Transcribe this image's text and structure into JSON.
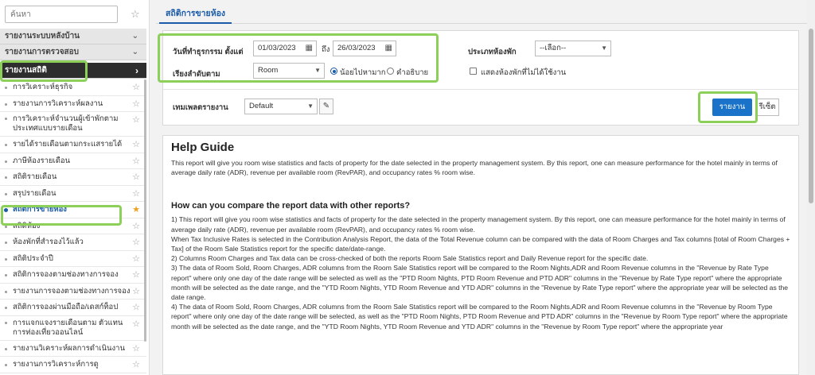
{
  "sidebar": {
    "search_placeholder": "ค้นหา",
    "groups": [
      {
        "label": "รายงานระบบหลังบ้าน"
      },
      {
        "label": "รายงานการตรวจสอบ"
      },
      {
        "label": "รายงานสถิติ"
      }
    ],
    "items": [
      {
        "label": "การวิเคราะห์ธุรกิจ"
      },
      {
        "label": "รายงานการวิเคราะห์ผลงาน"
      },
      {
        "label": "การวิเคราะห์จำนวนผู้เข้าพักตามประเทศแบบรายเดือน"
      },
      {
        "label": "รายได้รายเดือนตามกระแสรายได้"
      },
      {
        "label": "ภาษีห้องรายเดือน"
      },
      {
        "label": "สถิติรายเดือน"
      },
      {
        "label": "สรุปรายเดือน"
      },
      {
        "label": "สถิติการขายห้อง"
      },
      {
        "label": "สถิติห้อง"
      },
      {
        "label": "ห้องพักที่สำรองไว้แล้ว"
      },
      {
        "label": "สถิติประจำปี"
      },
      {
        "label": "สถิติการจองตามช่องทางการจอง"
      },
      {
        "label": "รายงานการจองตามช่องทางการจอง"
      },
      {
        "label": "สถิติการจองผ่านมือถือ/เดสก์ท็อป"
      },
      {
        "label": "การแจกแจงรายเดือนตาม ตัวแทนการท่องเที่ยวออนไลน์"
      },
      {
        "label": "รายงานวิเคราะห์ผลการดำเนินงาน"
      },
      {
        "label": "รายงานการวิเคราะห์การดู"
      }
    ]
  },
  "tab": {
    "label": "สถิติการขายห้อง"
  },
  "filters": {
    "date_label": "วันที่ทำธุรกรรม ตั้งแต่",
    "date_from": "01/03/2023",
    "to_label": "ถึง",
    "date_to": "26/03/2023",
    "room_type_label": "ประเภทห้องพัก",
    "room_type_value": "--เลือก--",
    "sort_label": "เรียงลำดับตาม",
    "sort_value": "Room",
    "order_asc_label": "น้อยไปหามาก",
    "order_desc_label": "คำอธิบาย",
    "show_unused_label": "แสดงห้องพักที่ไม่ได้ใช้งาน",
    "template_label": "เทมเพลตรายงาน",
    "template_value": "Default",
    "report_button": "รายงาน",
    "reset_button": "รีเซ็ต"
  },
  "help": {
    "title": "Help Guide",
    "intro": "This report will give you room wise statistics and facts of property for the date selected in the property management system. By this report, one can measure performance for the hotel mainly in terms of average daily rate (ADR), revenue per available room (RevPAR), and occupancy rates % room wise.",
    "subtitle": "How can you compare the report data with other reports?",
    "p1": "1) This report will give you room wise statistics and facts of property for the date selected in the property management system. By this report, one can measure performance for the hotel mainly in terms of average daily rate (ADR), revenue per available room (RevPAR), and occupancy rates % room wise.",
    "p2": "When Tax Inclusive Rates is selected in the Contribution Analysis Report, the data of the Total Revenue column can be compared with the data of Room Charges and Tax columns [total of Room Charges + Tax] of the Room Sale Statistics report for the specific date/date-range.",
    "p3": "2) Columns Room Charges and Tax data can be cross-checked of both the reports Room Sale Statistics report and Daily Revenue report for the specific date.",
    "p4": "3) The data of Room Sold, Room Charges, ADR columns from the Room Sale Statistics report will be compared to the Room Nights,ADR and Room Revenue columns in the \"Revenue by Rate Type report\" where only one day of the date range will be selected as well as the \"PTD Room Nights, PTD Room Revenue and PTD ADR\" columns in the \"Revenue by Rate Type report\" where the appropriate month will be selected as the date range, and the \"YTD Room Nights, YTD Room Revenue and YTD ADR\" columns in the \"Revenue by Rate Type report\" where the appropriate year will be selected as the date range.",
    "p5": "4) The data of Room Sold, Room Charges, ADR columns from the Room Sale Statistics report will be compared to the Room Nights,ADR and Room Revenue columns in the \"Revenue by Room Type report\" where only one day of the date range will be selected, as well as the \"PTD Room Nights, PTD Room Revenue and PTD ADR\" columns in the \"Revenue by Room Type report\" where the appropriate month will be selected as the date range, and the \"YTD Room Nights, YTD Room Revenue and YTD ADR\" columns in the \"Revenue by Room Type report\" where the appropriate year"
  },
  "colors": {
    "accent": "#1a73c8",
    "highlight": "#8cd05a",
    "active_group": "#2e2e2e",
    "favorite_star": "#f0a020"
  },
  "icons": {
    "star": "star-icon",
    "calendar": "calendar-icon",
    "edit": "edit-icon",
    "chevron": "chevron-down-icon"
  }
}
